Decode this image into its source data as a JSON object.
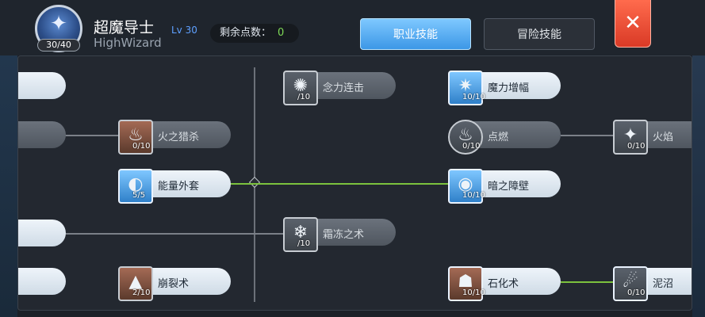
{
  "header": {
    "class_name": "超魔导士",
    "class_level": "Lv 30",
    "class_en": "HighWizard",
    "skill_points": "30/40",
    "remaining_label": "剩余点数：",
    "remaining_value": "0"
  },
  "tabs": [
    {
      "label": "职业技能",
      "active": true
    },
    {
      "label": "冒险技能",
      "active": false
    }
  ],
  "close_glyph": "✕",
  "skills": [
    {
      "id": "fire-wall",
      "label": "火之猎杀",
      "level": "0/10",
      "icon": "fire-icon",
      "learned": false
    },
    {
      "id": "energy-coat",
      "label": "能量外套",
      "level": "5/5",
      "icon": "energy-coat-icon",
      "learned": true
    },
    {
      "id": "heavens-drive",
      "label": "崩裂术",
      "level": "2/10",
      "icon": "earth-spike-icon",
      "learned": false
    },
    {
      "id": "napalm-vulcan",
      "label": "念力连击",
      "level": "/10",
      "icon": "psychic-burst-icon",
      "learned": false
    },
    {
      "id": "frost-nova",
      "label": "霜冻之术",
      "level": "/10",
      "icon": "frost-icon",
      "learned": false
    },
    {
      "id": "magic-amplify",
      "label": "魔力增幅",
      "level": "10/10",
      "icon": "magic-amplify-icon",
      "learned": true
    },
    {
      "id": "ignite",
      "label": "点燃",
      "level": "0/10",
      "icon": "ignite-icon",
      "learned": false
    },
    {
      "id": "dark-barrier",
      "label": "暗之障壁",
      "level": "10/10",
      "icon": "barrier-icon",
      "learned": true
    },
    {
      "id": "stone-curse",
      "label": "石化术",
      "level": "10/10",
      "icon": "stone-curse-icon",
      "learned": true
    },
    {
      "id": "fire-pillar",
      "label": "火焰",
      "level": "0/10",
      "icon": "fire-pillar-icon",
      "learned": false
    },
    {
      "id": "quagmire",
      "label": "泥沼",
      "level": "0/10",
      "icon": "quagmire-icon",
      "learned": true
    }
  ]
}
